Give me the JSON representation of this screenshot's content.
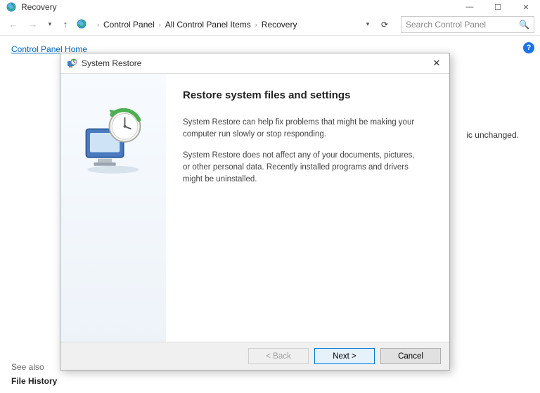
{
  "window": {
    "title": "Recovery"
  },
  "nav": {
    "crumbs": [
      "Control Panel",
      "All Control Panel Items",
      "Recovery"
    ],
    "search_placeholder": "Search Control Panel"
  },
  "page": {
    "control_panel_home": "Control Panel Home",
    "bg_line": "ic unchanged.",
    "see_also": "See also",
    "file_history": "File History"
  },
  "dialog": {
    "title": "System Restore",
    "heading": "Restore system files and settings",
    "para1": "System Restore can help fix problems that might be making your computer run slowly or stop responding.",
    "para2": "System Restore does not affect any of your documents, pictures, or other personal data. Recently installed programs and drivers might be uninstalled.",
    "back": "< Back",
    "next": "Next >",
    "cancel": "Cancel"
  }
}
